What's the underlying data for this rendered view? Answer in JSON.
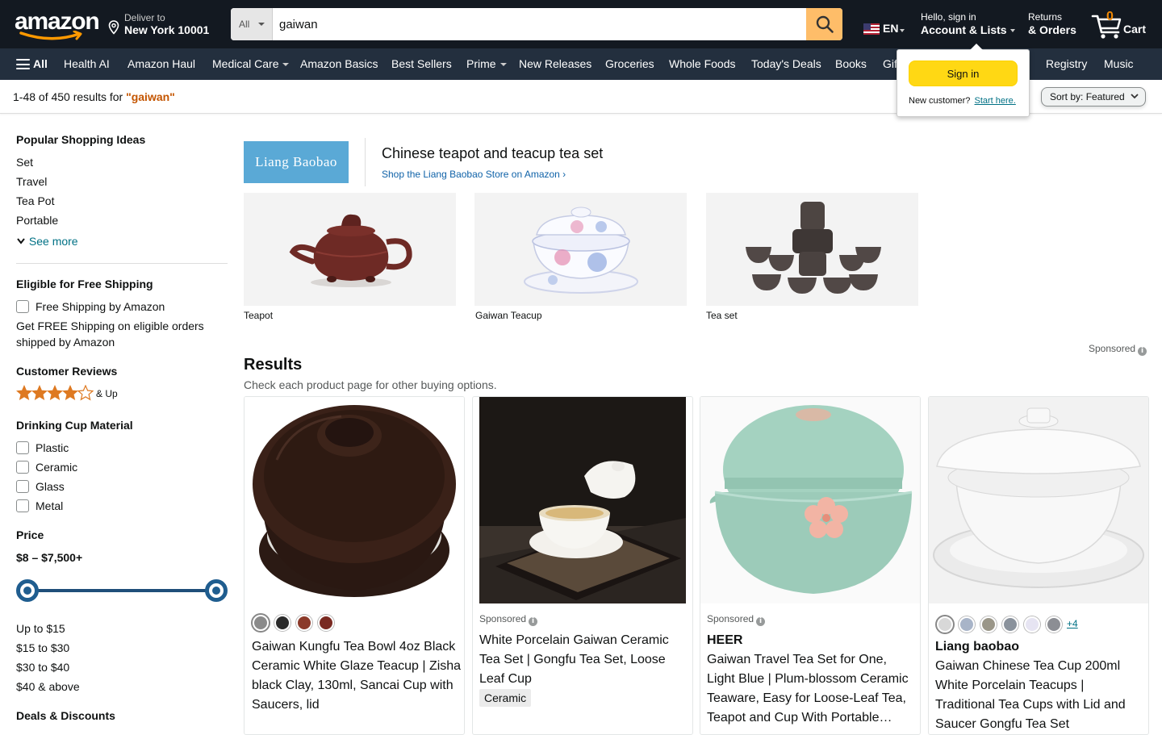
{
  "header": {
    "logo_text": "amazon",
    "deliver_line1": "Deliver to",
    "deliver_line2": "New York 10001",
    "search_dept": "All",
    "search_value": "gaiwan",
    "lang": "EN",
    "account_line1": "Hello, sign in",
    "account_line2": "Account & Lists",
    "returns_line1": "Returns",
    "returns_line2": "& Orders",
    "cart_count": "0",
    "cart_label": "Cart"
  },
  "subnav": {
    "all": "All",
    "items": [
      "Health AI",
      "Amazon Haul",
      "Medical Care",
      "Amazon Basics",
      "Best Sellers",
      "Prime",
      "New Releases",
      "Groceries",
      "Whole Foods",
      "Today's Deals",
      "Books",
      "Gif",
      "Registry",
      "Music"
    ]
  },
  "flyout": {
    "sign_in": "Sign in",
    "new_customer": "New customer?",
    "start_here": "Start here."
  },
  "results_bar": {
    "count_text": "1-48 of 450 results for",
    "query": "\"gaiwan\"",
    "sort_label": "Sort by:",
    "sort_value": "Featured"
  },
  "sidebar": {
    "popular_heading": "Popular Shopping Ideas",
    "popular_items": [
      "Set",
      "Travel",
      "Tea Pot",
      "Portable"
    ],
    "see_more": "See more",
    "shipping_heading": "Eligible for Free Shipping",
    "shipping_option": "Free Shipping by Amazon",
    "shipping_note_1": "Get FREE Shipping on eligible orders",
    "shipping_note_2": "shipped by Amazon",
    "reviews_heading": "Customer Reviews",
    "reviews_up": "& Up",
    "reviews_rating": 4,
    "material_heading": "Drinking Cup Material",
    "materials": [
      "Plastic",
      "Ceramic",
      "Glass",
      "Metal"
    ],
    "price_heading": "Price",
    "price_range": "$8 – $7,500+",
    "price_slider_min": 0,
    "price_slider_max": 1,
    "price_buckets": [
      "Up to $15",
      "$15 to $30",
      "$30 to $40",
      "$40 & above"
    ],
    "deals_heading": "Deals & Discounts"
  },
  "brand_banner": {
    "logo_text": "Liang Baobao",
    "headline": "Chinese teapot and teacup tea set",
    "store_link": "Shop the Liang Baobao Store on Amazon ›",
    "tiles": [
      "Teapot",
      "Gaiwan Teacup",
      "Tea set"
    ],
    "sponsored": "Sponsored"
  },
  "results": {
    "heading": "Results",
    "subheading": "Check each product page for other buying options.",
    "products": [
      {
        "title": "Gaiwan Kungfu Tea Bowl 4oz Black Ceramic White Glaze Teacup | Zisha black Clay, 130ml, Sancai Cup with Saucers, lid",
        "swatches": [
          "#8a8a8a",
          "#2b2b2b",
          "#8b3a2a",
          "#7a2a22"
        ]
      },
      {
        "sponsored": "Sponsored",
        "title": "White Porcelain Gaiwan Ceramic Tea Set | Gongfu Tea Set, Loose Leaf Cup",
        "tag": "Ceramic"
      },
      {
        "sponsored": "Sponsored",
        "brand": "HEER",
        "title": "Gaiwan Travel Tea Set for One, Light Blue | Plum-blossom Ceramic Teaware, Easy for Loose-Leaf Tea, Teapot and Cup With Portable…"
      },
      {
        "brand": "Liang baobao",
        "title": "Gaiwan Chinese Tea Cup 200ml White Porcelain Teacups | Traditional Tea Cups with Lid and Saucer Gongfu Tea Set",
        "swatches": [
          "#d8d8d8",
          "#a8b4c8",
          "#9a9688",
          "#8a929c",
          "#e6e4f2",
          "#8c8e94"
        ],
        "more_swatches": "+4"
      }
    ]
  },
  "colors": {
    "nav_top": "#131921",
    "nav_sub": "#232f3e",
    "search_button": "#febd69",
    "sign_in_button": "#ffd814",
    "cart_count": "#f08804",
    "query_highlight": "#c45500",
    "link": "#007185",
    "star": "#de7921"
  }
}
